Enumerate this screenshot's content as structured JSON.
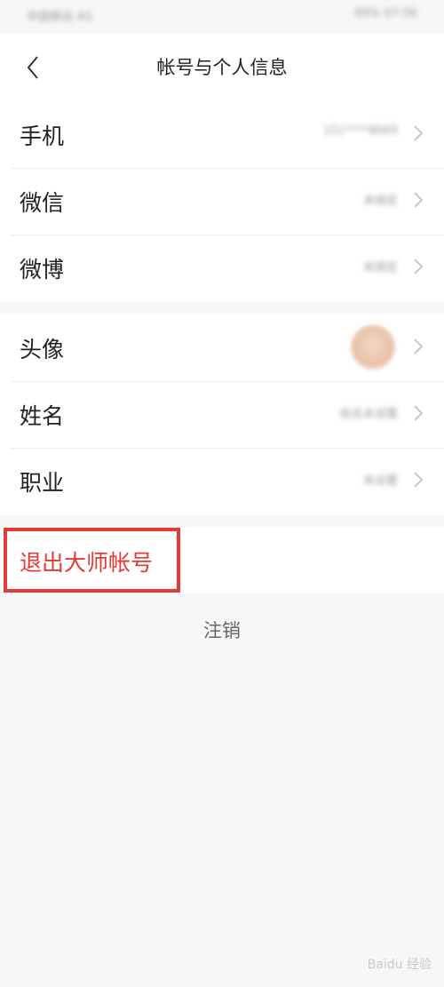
{
  "status_bar": {
    "left_text": "中国移动 4G",
    "right_text": "89% 07:56"
  },
  "header": {
    "title": "帐号与个人信息"
  },
  "group1": [
    {
      "label": "手机",
      "value": "151****8669"
    },
    {
      "label": "微信",
      "value": "未绑定"
    },
    {
      "label": "微博",
      "value": "未绑定"
    }
  ],
  "group2": [
    {
      "label": "头像"
    },
    {
      "label": "姓名",
      "value": "姓名未设置"
    },
    {
      "label": "职业",
      "value": "未设置"
    }
  ],
  "logout": {
    "label": "退出大师帐号"
  },
  "cancel": {
    "label": "注销"
  },
  "watermark": "Baidu 经验",
  "colors": {
    "accent_red": "#e53935",
    "background": "#f7f7f9"
  },
  "icons": {
    "back": "chevron-left-icon",
    "row_arrow": "chevron-right-icon"
  }
}
